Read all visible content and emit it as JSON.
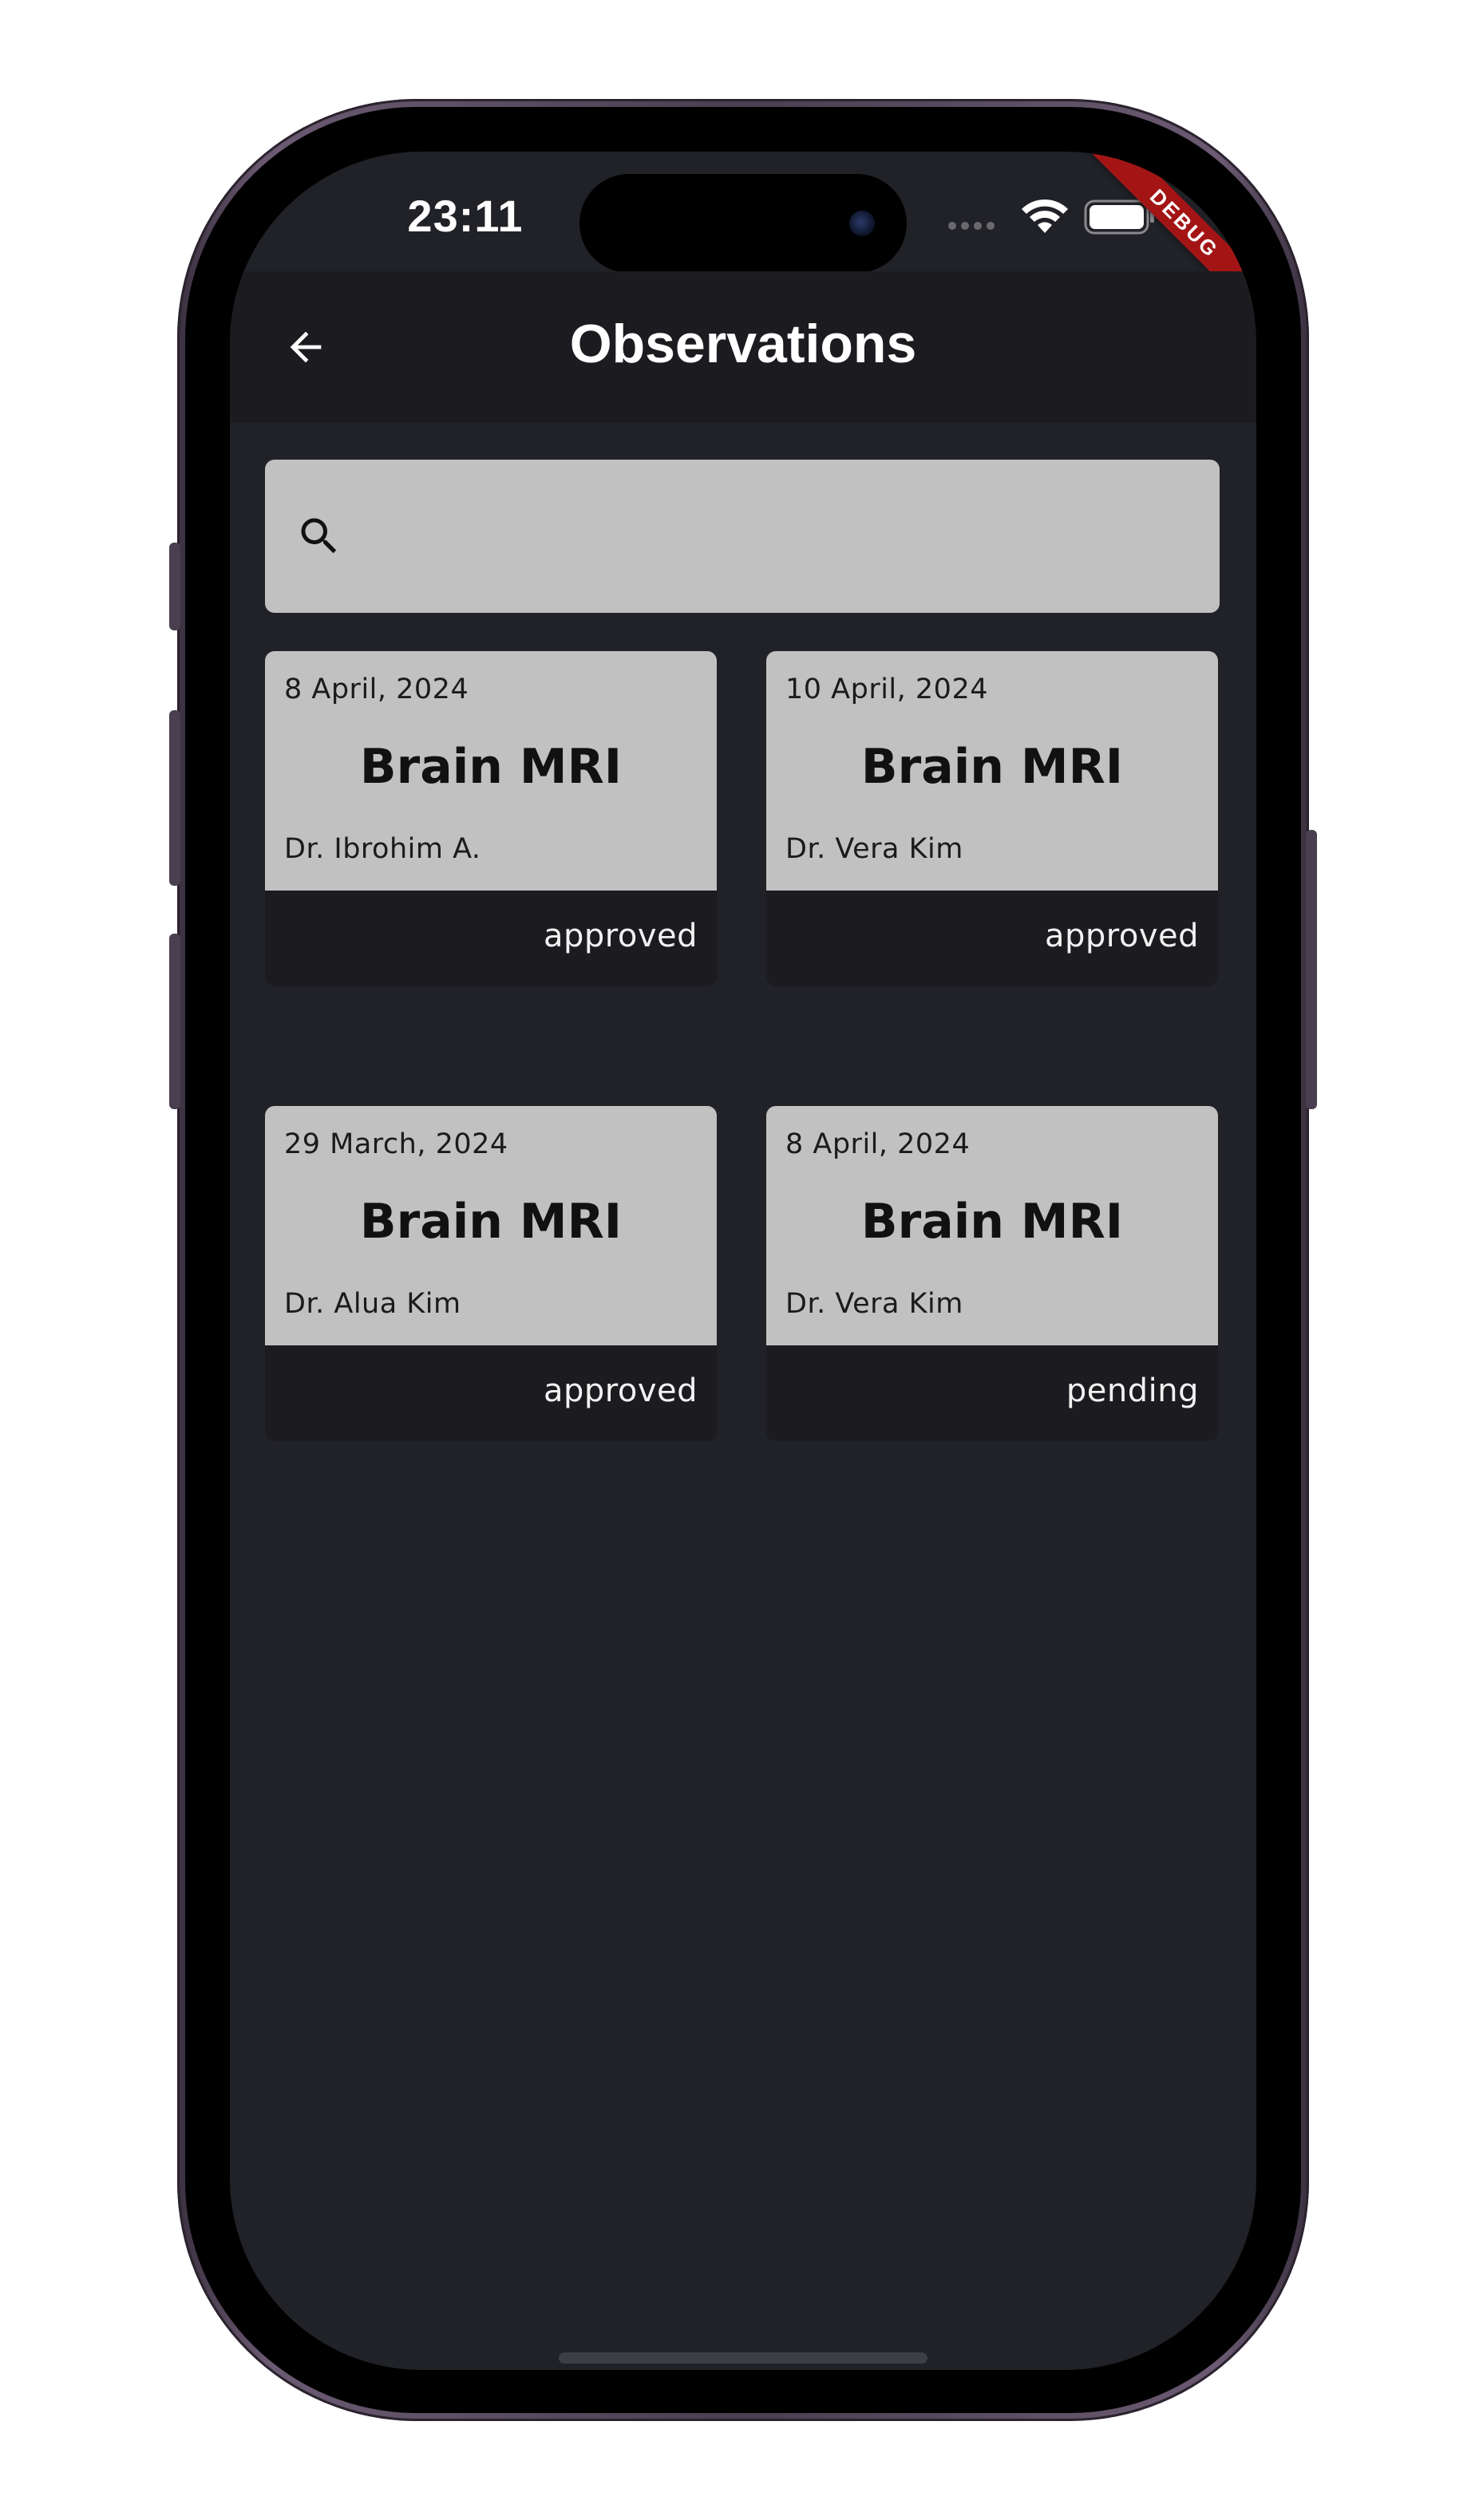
{
  "status_bar": {
    "time": "23:11",
    "debug_banner": "DEBUG"
  },
  "app_bar": {
    "title": "Observations"
  },
  "search": {
    "placeholder": "",
    "value": ""
  },
  "observations": [
    {
      "date": "8 April, 2024",
      "title": "Brain MRI",
      "doctor": "Dr. Ibrohim A.",
      "status": "approved"
    },
    {
      "date": "10 April, 2024",
      "title": "Brain MRI",
      "doctor": "Dr. Vera Kim",
      "status": "approved"
    },
    {
      "date": "29 March, 2024",
      "title": "Brain MRI",
      "doctor": "Dr. Alua Kim",
      "status": "approved"
    },
    {
      "date": "8 April, 2024",
      "title": "Brain MRI",
      "doctor": "Dr. Vera Kim",
      "status": "pending"
    }
  ],
  "icons": {
    "back": "arrow-left-icon",
    "search": "search-icon",
    "wifi": "wifi-icon",
    "battery": "battery-icon",
    "signal": "cellular-signal-icon"
  },
  "colors": {
    "background": "#212227",
    "app_bar": "#1c1c20",
    "card_surface": "#c1c1c1",
    "debug_ribbon": "#a31515"
  }
}
